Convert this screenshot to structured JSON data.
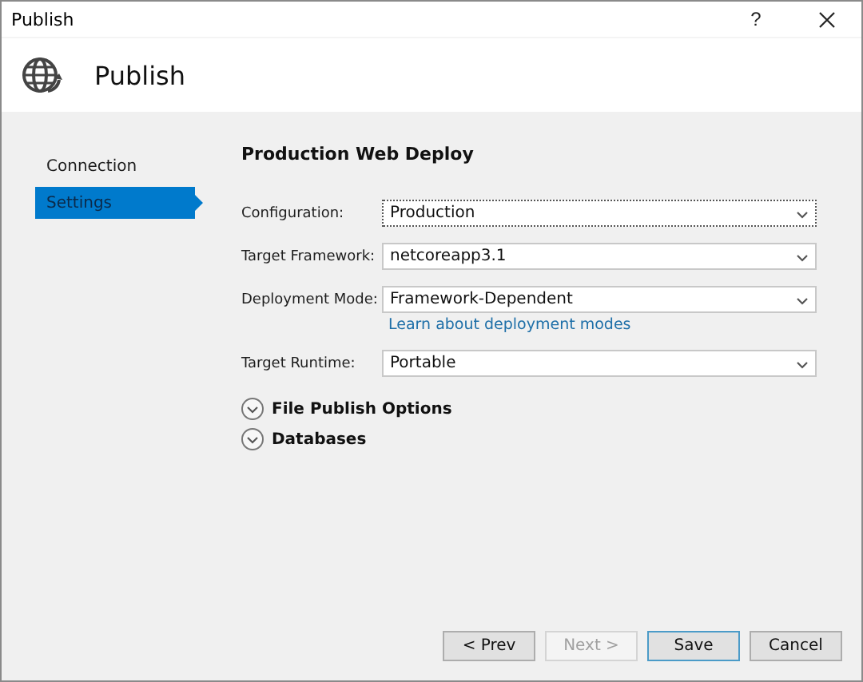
{
  "window": {
    "title": "Publish",
    "help": "?"
  },
  "header": {
    "title": "Publish"
  },
  "sidebar": {
    "items": [
      {
        "label": "Connection",
        "selected": false
      },
      {
        "label": "Settings",
        "selected": true
      }
    ]
  },
  "content": {
    "heading": "Production Web Deploy",
    "fields": [
      {
        "label": "Configuration:",
        "value": "Production",
        "focused": true
      },
      {
        "label": "Target Framework:",
        "value": "netcoreapp3.1",
        "focused": false
      },
      {
        "label": "Deployment Mode:",
        "value": "Framework-Dependent",
        "focused": false,
        "link": "Learn about deployment modes"
      },
      {
        "label": "Target Runtime:",
        "value": "Portable",
        "focused": false
      }
    ],
    "sections": [
      {
        "label": "File Publish Options",
        "expanded": false
      },
      {
        "label": "Databases",
        "expanded": false
      }
    ]
  },
  "buttons": [
    {
      "label": "< Prev",
      "disabled": false,
      "default": false
    },
    {
      "label": "Next >",
      "disabled": true,
      "default": false
    },
    {
      "label": "Save",
      "disabled": false,
      "default": true
    },
    {
      "label": "Cancel",
      "disabled": false,
      "default": false
    }
  ]
}
